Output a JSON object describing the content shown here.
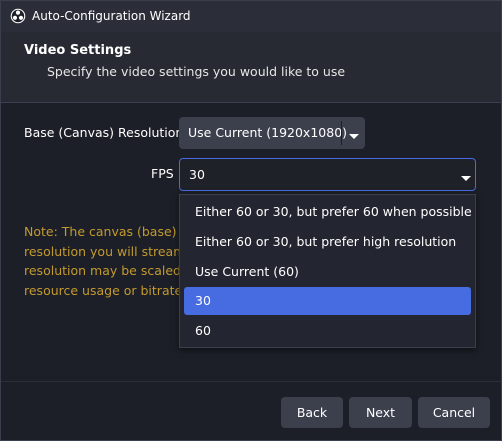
{
  "window": {
    "title": "Auto-Configuration Wizard",
    "app_icon": "obs-logo-icon"
  },
  "header": {
    "title": "Video Settings",
    "subtitle": "Specify the video settings you would like to use"
  },
  "form": {
    "resolution_label": "Base (Canvas) Resolution",
    "resolution_value": "Use Current (1920x1080)",
    "fps_label": "FPS",
    "fps_value": "30"
  },
  "note": {
    "lines": [
      "Note: The canvas (base) re",
      "resolution you will stream",
      "resolution may be scaled d",
      "resource usage or bitrate r"
    ],
    "color": "#c49a2f"
  },
  "fps_dropdown": {
    "options": [
      "Either 60 or 30, but prefer 60 when possible",
      "Either 60 or 30, but prefer high resolution",
      "Use Current (60)",
      "30",
      "60"
    ],
    "selected_index": 3,
    "accent_color": "#476be0"
  },
  "buttons": {
    "back": "Back",
    "next": "Next",
    "cancel": "Cancel"
  }
}
